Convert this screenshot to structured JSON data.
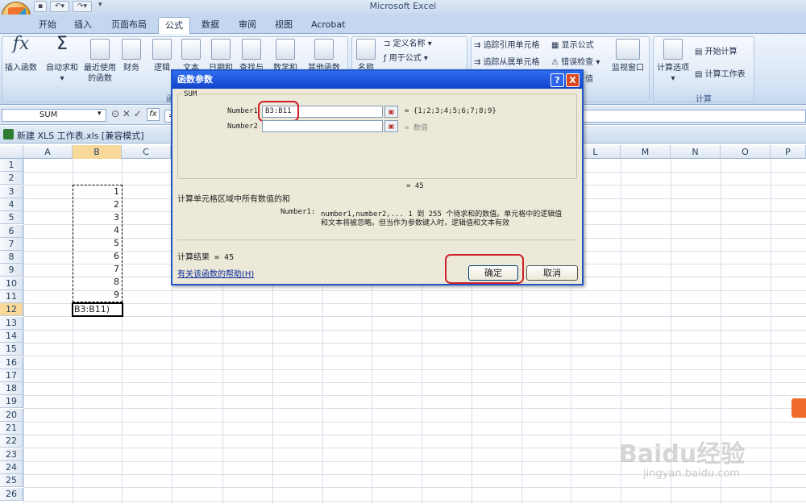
{
  "window": {
    "title": "Microsoft Excel"
  },
  "tabs": [
    "开始",
    "插入",
    "页面布局",
    "公式",
    "数据",
    "审阅",
    "视图",
    "Acrobat"
  ],
  "active_tab": "公式",
  "ribbon": {
    "insert_function": "插入函数",
    "autosum": "自动求和",
    "recent_label": "最近使用",
    "recent_label2": "的函数",
    "financial": "财务",
    "logical": "逻辑",
    "text": "文本",
    "datetime": "日期和",
    "lookup": "查找与",
    "math": "数学和",
    "other": "其他函数",
    "name_manager": "名称",
    "define_name": "定义名称",
    "use_in_formula": "用于公式",
    "trace_precedents": "追踪引用单元格",
    "trace_dependents": "追踪从属单元格",
    "show_formulas": "显示公式",
    "error_check": "错误检查",
    "evaluate": "值",
    "watch_window": "监视窗口",
    "calc_options": "计算选项",
    "calc_now": "开始计算",
    "calc_sheet": "计算工作表",
    "group_func_lib": "函",
    "group_calc": "计算"
  },
  "formula_bar": {
    "name_box": "SUM",
    "fx": "fx",
    "eq": "="
  },
  "workbook": {
    "title": "新建 XLS 工作表.xls [兼容模式]"
  },
  "columns": [
    "A",
    "B",
    "C",
    "L",
    "M",
    "N",
    "O",
    "P"
  ],
  "rows": [
    "1",
    "2",
    "3",
    "4",
    "5",
    "6",
    "7",
    "8",
    "9",
    "10",
    "11",
    "12",
    "13",
    "14",
    "15",
    "16",
    "17",
    "18",
    "19",
    "20",
    "21",
    "22",
    "23",
    "24",
    "25",
    "26"
  ],
  "cells_b": [
    "1",
    "2",
    "3",
    "4",
    "5",
    "6",
    "7",
    "8",
    "9"
  ],
  "active_cell_text": "B3:B11)",
  "dialog": {
    "title": "函数参数",
    "help_btn": "?",
    "close_btn": "X",
    "func_name": "SUM",
    "arg1_label": "Number1",
    "arg1_value": "B3:B11",
    "arg1_result": "= {1;2;3;4;5;6;7;8;9}",
    "arg2_label": "Number2",
    "arg2_result": "= 数值",
    "total": "= 45",
    "description": "计算单元格区域中所有数值的和",
    "arg_help_label": "Number1:",
    "arg_help_line1": "number1,number2,...  1 到 255 个待求和的数值。单元格中的逻辑值",
    "arg_help_line2": "和文本将被忽略。但当作为参数键入时，逻辑值和文本有效",
    "result_line": "计算结果 = 45",
    "help_link": "有关该函数的帮助(H)",
    "ok": "确定",
    "cancel": "取消"
  },
  "watermark": {
    "brand": "Baidu经验",
    "url": "jingyan.baidu.com"
  },
  "colors": {
    "dialog_title": "#1f55c9",
    "highlight": "#d0202a",
    "active_col": "#f9d99a"
  }
}
